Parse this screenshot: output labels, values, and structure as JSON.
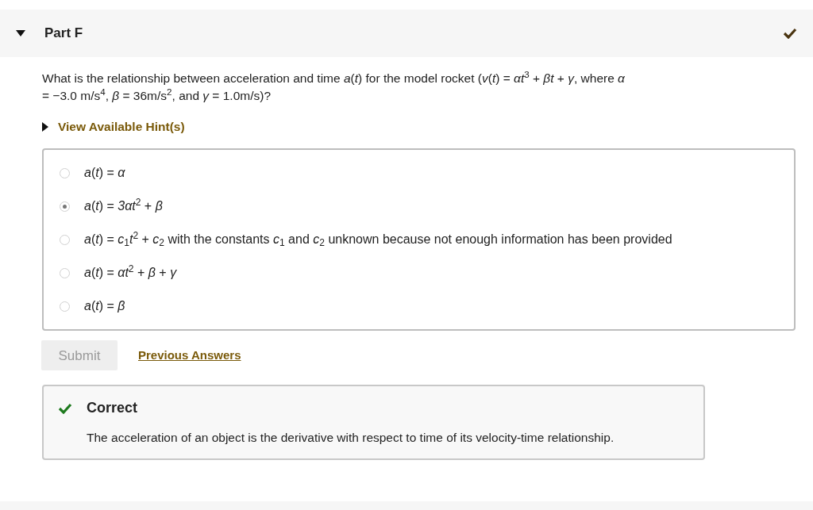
{
  "part": {
    "title": "Part F",
    "expanded": true,
    "completed": true
  },
  "question": "What is the relationship between acceleration and time *a*(*t*) for the model rocket (*v*(*t*) = *αt*$^{3}$ + *βt* + *γ*, where *α* = −3.0 m/s$^{4}$, *β* = 36m/s$^{2}$, and *γ* = 1.0m/s)?",
  "hints": {
    "label": "View Available Hint(s)",
    "expanded": false
  },
  "options": [
    {
      "text": "*a*(*t*) = *α*",
      "selected": false
    },
    {
      "text": "*a*(*t*) = *3αt*$^{2}$ + *β*",
      "selected": true
    },
    {
      "text": "*a*(*t*) = *c*$_{1}$*t*$^{2}$ + *c*$_{2}$ with the constants *c*$_{1}$ and *c*$_{2}$ unknown because not enough information has been provided",
      "selected": false
    },
    {
      "text": "*a*(*t*) = *αt*$^{2}$ + *β* + *γ*",
      "selected": false
    },
    {
      "text": "*a*(*t*) = *β*",
      "selected": false
    }
  ],
  "submit": {
    "label": "Submit",
    "disabled": true
  },
  "previous_answers": "Previous Answers",
  "feedback": {
    "kind": "correct",
    "title": "Correct",
    "message": "The acceleration of an object is the derivative with respect to time of its velocity-time relationship."
  }
}
